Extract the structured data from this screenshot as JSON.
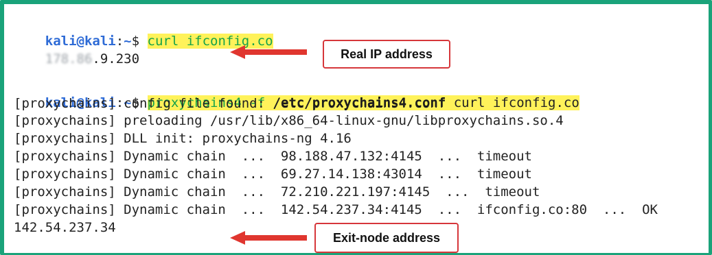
{
  "terminal": {
    "prompt_user": "kali@kali",
    "prompt_sep": ":",
    "prompt_path": "~",
    "prompt_symbol": "$",
    "cmd1": "curl ifconfig.co",
    "ip_hidden": "178.86",
    "ip_visible": ".9.230",
    "cmd2_prog": "proxychains4",
    "cmd2_flag": "-f",
    "cmd2_conf": "/etc/proxychains4.conf",
    "cmd2_rest": "curl ifconfig.co",
    "output": [
      "[proxychains] config file found: /etc/proxychains4.conf",
      "[proxychains] preloading /usr/lib/x86_64-linux-gnu/libproxychains.so.4",
      "[proxychains] DLL init: proxychains-ng 4.16",
      "[proxychains] Dynamic chain  ...  98.188.47.132:4145  ...  timeout",
      "[proxychains] Dynamic chain  ...  69.27.14.138:43014  ...  timeout",
      "[proxychains] Dynamic chain  ...  72.210.221.197:4145  ...  timeout",
      "[proxychains] Dynamic chain  ...  142.54.237.34:4145  ...  ifconfig.co:80  ...  OK"
    ],
    "exit_ip": "142.54.237.34"
  },
  "callouts": {
    "real_ip": "Real IP address",
    "exit_node": "Exit-node address"
  },
  "colors": {
    "frame": "#1aa37a",
    "highlight": "#fff25a",
    "callout_border": "#d6363a",
    "arrow": "#e0362f"
  }
}
